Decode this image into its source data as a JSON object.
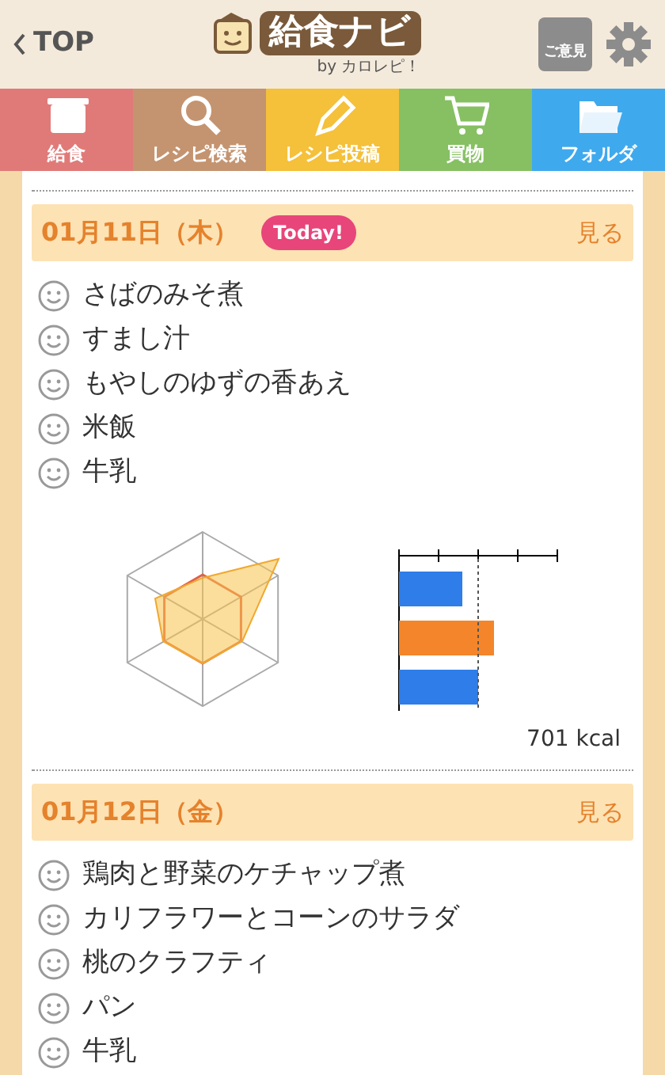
{
  "header": {
    "back": "TOP",
    "logo_title": "給食ナビ",
    "logo_sub": "by カロレピ！",
    "feedback": "ご意見"
  },
  "tabs": [
    {
      "label": "給食",
      "color": "#e07a78",
      "kind": "pot"
    },
    {
      "label": "レシピ検索",
      "color": "#c49470",
      "kind": "search"
    },
    {
      "label": "レシピ投稿",
      "color": "#f5c03a",
      "kind": "pencil"
    },
    {
      "label": "買物",
      "color": "#86c062",
      "kind": "cart"
    },
    {
      "label": "フォルダ",
      "color": "#3fa9ee",
      "kind": "folder"
    }
  ],
  "days": [
    {
      "date": "01月11日（木）",
      "badge": "Today!",
      "link": "見る",
      "menu": [
        "さばのみそ煮",
        "すまし汁",
        "もやしのゆずの香あえ",
        "米飯",
        "牛乳"
      ],
      "nutrition": {
        "kcal": "701 kcal"
      }
    },
    {
      "date": "01月12日（金）",
      "link": "見る",
      "menu": [
        "鶏肉と野菜のケチャップ煮",
        "カリフラワーとコーンのサラダ",
        "桃のクラフティ",
        "パン",
        "牛乳"
      ]
    }
  ]
}
